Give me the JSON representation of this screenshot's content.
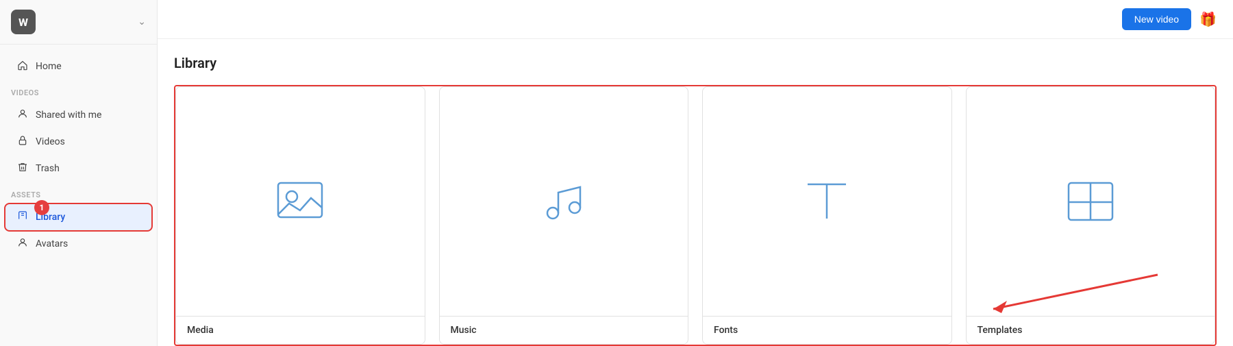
{
  "sidebar": {
    "logo": "W",
    "sections": [
      {
        "label": "",
        "items": [
          {
            "id": "home",
            "label": "Home",
            "icon": "🏠",
            "active": false
          }
        ]
      },
      {
        "label": "Videos",
        "items": [
          {
            "id": "shared-with-me",
            "label": "Shared with me",
            "icon": "👤",
            "active": false
          },
          {
            "id": "videos",
            "label": "Videos",
            "icon": "🔒",
            "active": false
          },
          {
            "id": "trash",
            "label": "Trash",
            "icon": "🗑",
            "active": false
          }
        ]
      },
      {
        "label": "Assets",
        "items": [
          {
            "id": "library",
            "label": "Library",
            "icon": "📖",
            "active": true,
            "badge": "1"
          },
          {
            "id": "avatars",
            "label": "Avatars",
            "icon": "👤",
            "active": false
          }
        ]
      }
    ]
  },
  "header": {
    "new_video_label": "New video",
    "gift_icon": "🎁"
  },
  "page": {
    "title": "Library",
    "cards": [
      {
        "id": "media",
        "label": "Media"
      },
      {
        "id": "music",
        "label": "Music"
      },
      {
        "id": "fonts",
        "label": "Fonts"
      },
      {
        "id": "templates",
        "label": "Templates"
      }
    ]
  },
  "icons": {
    "chevron": "›",
    "home": "⌂",
    "shared": "👤",
    "lock": "🔒",
    "trash": "🗑",
    "book": "📖",
    "avatar": "👤",
    "gift": "🎁"
  }
}
